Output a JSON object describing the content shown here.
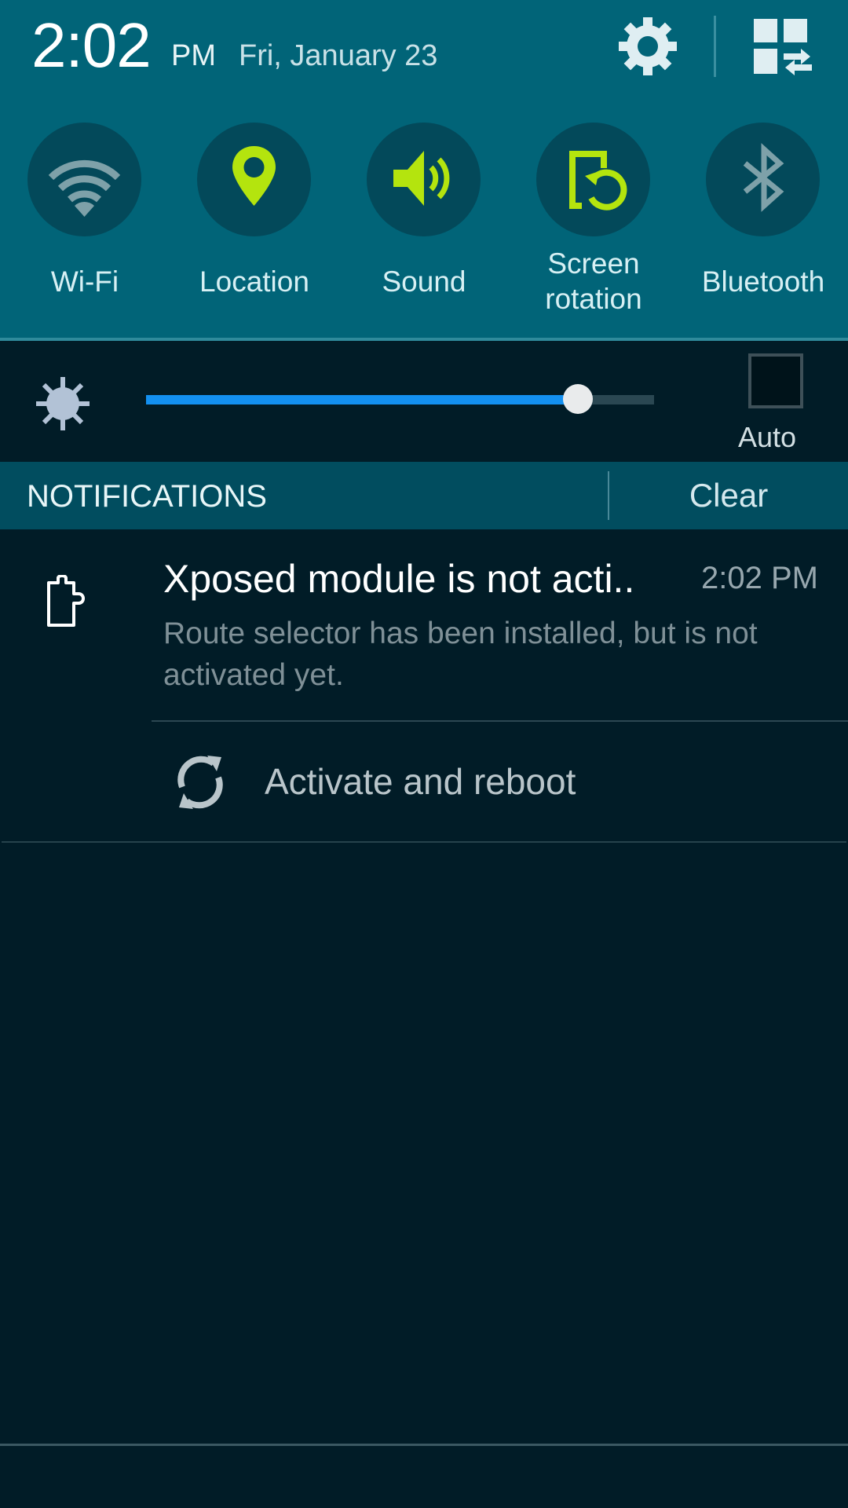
{
  "status": {
    "time": "2:02",
    "ampm": "PM",
    "date": "Fri, January 23",
    "settings_icon": "gear-icon",
    "edit_icon": "quick-settings-edit-icon"
  },
  "quick_toggles": [
    {
      "label": "Wi-Fi",
      "icon": "wifi-icon",
      "state": "off"
    },
    {
      "label": "Location",
      "icon": "location-pin-icon",
      "state": "on"
    },
    {
      "label": "Sound",
      "icon": "speaker-icon",
      "state": "on"
    },
    {
      "label_line1": "Screen",
      "label_line2": "rotation",
      "icon": "screen-rotation-icon",
      "state": "on"
    },
    {
      "label": "Bluetooth",
      "icon": "bluetooth-icon",
      "state": "off"
    }
  ],
  "colors": {
    "active": "#b4e40e",
    "inactive": "#7ea1a9",
    "header_bg": "#016478",
    "slider_fill": "#1390f0"
  },
  "brightness": {
    "value_fraction": 0.85,
    "auto_label": "Auto",
    "auto_checked": false
  },
  "notifications_bar": {
    "title": "NOTIFICATIONS",
    "clear_label": "Clear"
  },
  "notifications": [
    {
      "icon": "puzzle-piece-icon",
      "title": "Xposed module is not acti..",
      "time": "2:02 PM",
      "text": "Route selector has been installed, but is not activated yet.",
      "action": {
        "icon": "sync-icon",
        "label": "Activate and reboot"
      }
    }
  ]
}
